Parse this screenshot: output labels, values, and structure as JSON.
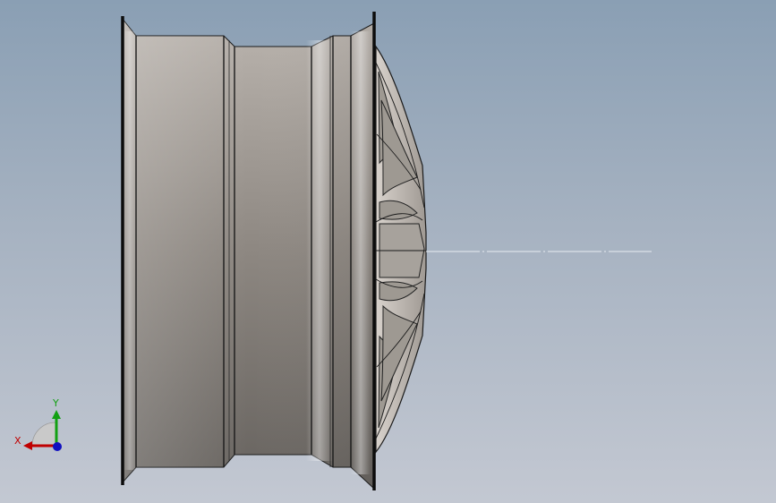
{
  "viewport": {
    "background_top": "#8a9fb4",
    "background_bottom": "#c3c8d2"
  },
  "model": {
    "name": "wheel-rim",
    "view": "side",
    "rim_color": "#8a8582",
    "rim_highlight": "#e8e3df",
    "outline_color": "#111111",
    "spoke_face_color": "#c8c3be"
  },
  "triad": {
    "x_label": "X",
    "y_label": "Y",
    "x_color": "#c00000",
    "y_color": "#12a012",
    "z_color": "#1010c0"
  }
}
